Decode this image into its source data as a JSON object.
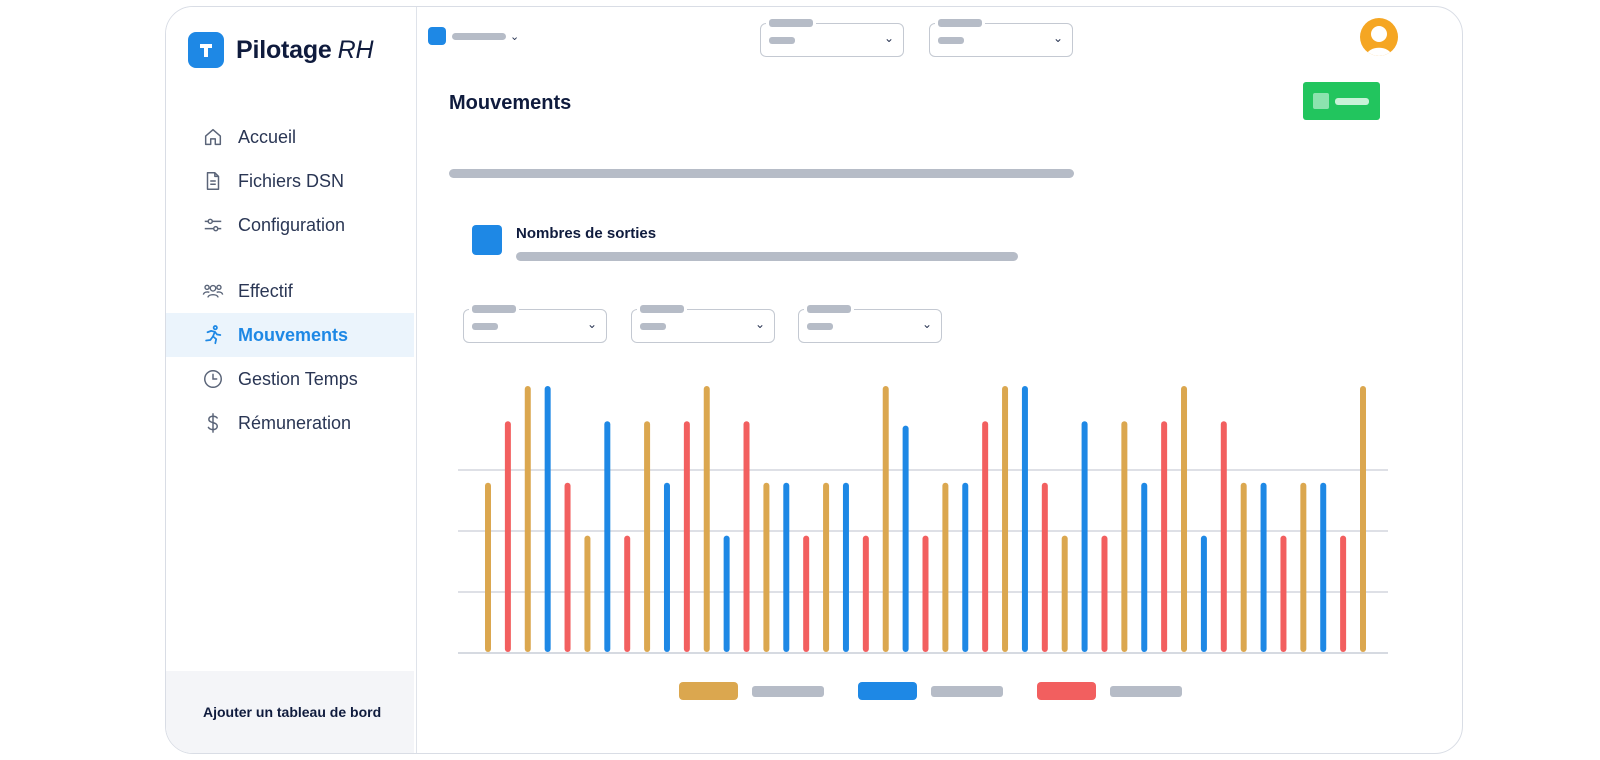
{
  "brand": {
    "name": "Pilotage",
    "suffix": "RH"
  },
  "sidebar": {
    "items": [
      {
        "label": "Accueil",
        "icon": "home-icon"
      },
      {
        "label": "Fichiers DSN",
        "icon": "file-icon"
      },
      {
        "label": "Configuration",
        "icon": "sliders-icon"
      },
      {
        "label": "Effectif",
        "icon": "users-icon"
      },
      {
        "label": "Mouvements",
        "icon": "running-person-icon",
        "active": true
      },
      {
        "label": "Gestion Temps",
        "icon": "clock-icon"
      },
      {
        "label": "Rémuneration",
        "icon": "dollar-icon"
      }
    ],
    "footer_label": "Ajouter un tableau de bord"
  },
  "main": {
    "title": "Mouvements",
    "card_title": "Nombres de sorties"
  },
  "colors": {
    "accent": "#1e88e5",
    "gold": "#dba74f",
    "blue": "#1e88e5",
    "red": "#f25f5f",
    "green": "#22c55e",
    "avatar": "#f5a623"
  },
  "chart_data": {
    "type": "bar",
    "title": "Nombres de sorties",
    "ylim": [
      0,
      6
    ],
    "grid": true,
    "legend_placement": "bottom-center",
    "series": [
      {
        "color": "#dba74f",
        "values": [
          4.2,
          2.8,
          2.8,
          3.2,
          4.2,
          6,
          3.2,
          5.6,
          3.6,
          3.8,
          4.2,
          4.2,
          2.6
        ]
      },
      {
        "color": "#1e88e5",
        "values": [
          6,
          5.2,
          4.2,
          2.6,
          4.3,
          4.2,
          5.1,
          6,
          5.2,
          4.2,
          2.6,
          4.3,
          4.2
        ]
      },
      {
        "color": "#f25f5f",
        "values": [
          5.2,
          2.6,
          5.2,
          5.2,
          2.6,
          2.6,
          2.6,
          4.3,
          2.6,
          5.2,
          5.2,
          2.6,
          2.6
        ]
      }
    ],
    "series_order_by_group": [
      [
        "#dba74f",
        "#f25f5f",
        "#dba74f"
      ],
      [
        "#1e88e5",
        "#f25f5f",
        "#dba74f"
      ],
      [
        "#1e88e5",
        "#f25f5f",
        "#dba74f"
      ],
      [
        "#1e88e5",
        "#f25f5f",
        "#dba74f"
      ],
      [
        "#1e88e5",
        "#f25f5f",
        "#dba74f"
      ],
      [
        "#1e88e5",
        "#dba74f",
        "#f25f5f"
      ],
      [
        "#1e88e5",
        "#f25f5f",
        "#dba74f"
      ]
    ],
    "bar_values": [
      {
        "c": "#dba74f",
        "v": 3.8
      },
      {
        "c": "#f25f5f",
        "v": 5.2
      },
      {
        "c": "#dba74f",
        "v": 6
      },
      {
        "c": "#1e88e5",
        "v": 6
      },
      {
        "c": "#f25f5f",
        "v": 3.8
      },
      {
        "c": "#dba74f",
        "v": 2.6
      },
      {
        "c": "#1e88e5",
        "v": 5.2
      },
      {
        "c": "#f25f5f",
        "v": 2.6
      },
      {
        "c": "#dba74f",
        "v": 5.2
      },
      {
        "c": "#1e88e5",
        "v": 3.8
      },
      {
        "c": "#f25f5f",
        "v": 5.2
      },
      {
        "c": "#dba74f",
        "v": 6
      },
      {
        "c": "#1e88e5",
        "v": 2.6
      },
      {
        "c": "#f25f5f",
        "v": 5.2
      },
      {
        "c": "#dba74f",
        "v": 3.8
      },
      {
        "c": "#1e88e5",
        "v": 3.8
      },
      {
        "c": "#f25f5f",
        "v": 2.6
      },
      {
        "c": "#dba74f",
        "v": 3.8
      },
      {
        "c": "#1e88e5",
        "v": 3.8
      },
      {
        "c": "#f25f5f",
        "v": 2.6
      },
      {
        "c": "#dba74f",
        "v": 6
      },
      {
        "c": "#1e88e5",
        "v": 5.1
      },
      {
        "c": "#f25f5f",
        "v": 2.6
      },
      {
        "c": "#dba74f",
        "v": 3.8
      },
      {
        "c": "#1e88e5",
        "v": 3.8
      },
      {
        "c": "#f25f5f",
        "v": 5.2
      },
      {
        "c": "#dba74f",
        "v": 6
      },
      {
        "c": "#1e88e5",
        "v": 6
      },
      {
        "c": "#f25f5f",
        "v": 3.8
      },
      {
        "c": "#dba74f",
        "v": 2.6
      },
      {
        "c": "#1e88e5",
        "v": 5.2
      },
      {
        "c": "#f25f5f",
        "v": 2.6
      },
      {
        "c": "#dba74f",
        "v": 5.2
      },
      {
        "c": "#1e88e5",
        "v": 3.8
      },
      {
        "c": "#f25f5f",
        "v": 5.2
      },
      {
        "c": "#dba74f",
        "v": 6
      },
      {
        "c": "#1e88e5",
        "v": 2.6
      },
      {
        "c": "#f25f5f",
        "v": 5.2
      },
      {
        "c": "#dba74f",
        "v": 3.8
      },
      {
        "c": "#1e88e5",
        "v": 3.8
      },
      {
        "c": "#f25f5f",
        "v": 2.6
      },
      {
        "c": "#dba74f",
        "v": 3.8
      },
      {
        "c": "#1e88e5",
        "v": 3.8
      },
      {
        "c": "#f25f5f",
        "v": 2.6
      },
      {
        "c": "#dba74f",
        "v": 6
      }
    ]
  }
}
